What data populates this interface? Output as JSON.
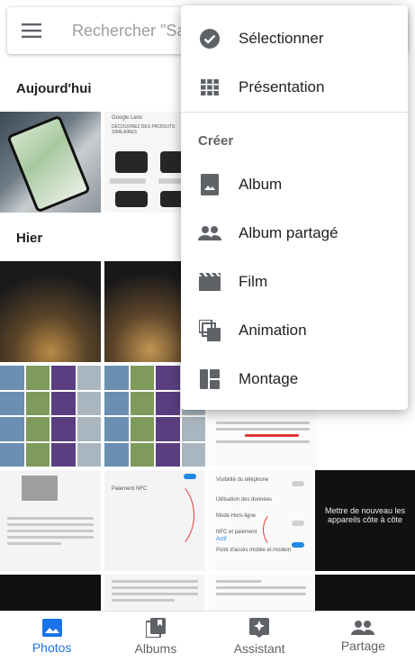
{
  "search": {
    "placeholder": "Rechercher \"Sa"
  },
  "sections": {
    "today": "Aujourd'hui",
    "yesterday": "Hier"
  },
  "menu": {
    "select": "Sélectionner",
    "layout": "Présentation",
    "create_header": "Créer",
    "album": "Album",
    "shared_album": "Album partagé",
    "movie": "Film",
    "animation": "Animation",
    "collage": "Montage"
  },
  "thumbs": {
    "lens_header": "Google Lens",
    "lens_similar": "DÉCOUVREZ DES PRODUITS SIMILAIRES",
    "phone_visibility": "Visibilité du téléphone",
    "data_usage": "Utilisation des données",
    "offline_mode": "Mode Hors-ligne",
    "nfc_payment": "NFC et paiement",
    "nfc_active": "Actif",
    "hotspot": "Point d'accès mobile et modem",
    "nfc_payment_short": "Paiement NFC",
    "dark_caption": "Mettre de nouveau les appareils côte à côte"
  },
  "nav": {
    "photos": "Photos",
    "albums": "Albums",
    "assistant": "Assistant",
    "sharing": "Partage"
  },
  "colors": {
    "accent": "#1a73e8",
    "icon_gray": "#5f6368"
  }
}
